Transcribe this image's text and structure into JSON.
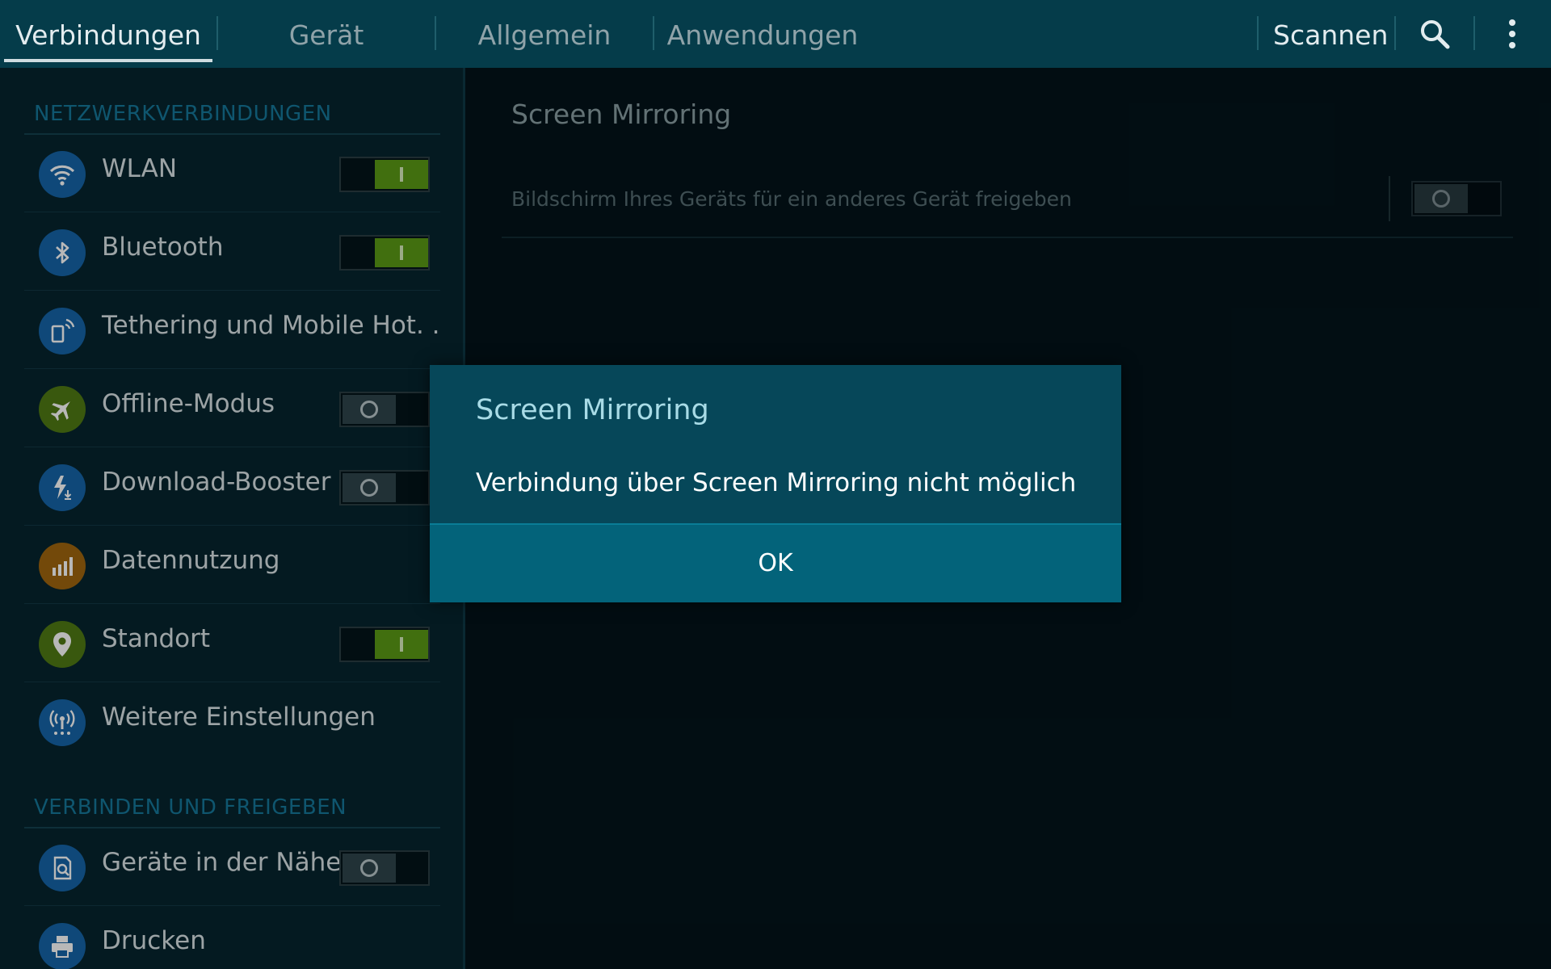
{
  "tabs": [
    {
      "label": "Verbindungen",
      "active": true
    },
    {
      "label": "Gerät",
      "active": false
    },
    {
      "label": "Allgemein",
      "active": false
    },
    {
      "label": "Anwendungen",
      "active": false
    }
  ],
  "actions": {
    "scan_label": "Scannen",
    "search_icon": "search-icon",
    "overflow_icon": "overflow-menu-icon"
  },
  "sidebar": {
    "sections": [
      {
        "header": "NETZWERKVERBINDUNGEN",
        "items": [
          {
            "label": "WLAN",
            "icon": "wifi-icon",
            "icon_color": "#1565a8",
            "toggle": "on"
          },
          {
            "label": "Bluetooth",
            "icon": "bluetooth-icon",
            "icon_color": "#1565a8",
            "toggle": "on"
          },
          {
            "label": "Tethering und Mobile Hot. .",
            "icon": "tethering-icon",
            "icon_color": "#1565a8",
            "toggle": "none"
          },
          {
            "label": "Offline-Modus",
            "icon": "airplane-icon",
            "icon_color": "#4f7a14",
            "toggle": "off"
          },
          {
            "label": "Download-Booster",
            "icon": "download-booster-icon",
            "icon_color": "#1565a8",
            "toggle": "off"
          },
          {
            "label": "Datennutzung",
            "icon": "data-usage-icon",
            "icon_color": "#a0660e",
            "toggle": "none"
          },
          {
            "label": "Standort",
            "icon": "location-icon",
            "icon_color": "#4f7a14",
            "toggle": "on"
          },
          {
            "label": "Weitere Einstellungen",
            "icon": "more-networks-icon",
            "icon_color": "#1565a8",
            "toggle": "none"
          }
        ]
      },
      {
        "header": "VERBINDEN UND FREIGEBEN",
        "items": [
          {
            "label": "Geräte in der Nähe",
            "icon": "nearby-devices-icon",
            "icon_color": "#1565a8",
            "toggle": "off"
          },
          {
            "label": "Drucken",
            "icon": "printer-icon",
            "icon_color": "#1565a8",
            "toggle": "none"
          }
        ]
      }
    ]
  },
  "content": {
    "title": "Screen Mirroring",
    "description": "Bildschirm Ihres Geräts für ein anderes Gerät freigeben",
    "toggle": "off"
  },
  "dialog": {
    "title": "Screen Mirroring",
    "message": "Verbindung über Screen Mirroring nicht möglich",
    "ok_label": "OK"
  },
  "colors": {
    "top_bar": "#053c4a",
    "sidebar_bg": "#06242e",
    "content_bg": "#03131a",
    "toggle_on": "#5a9a16",
    "section_header": "#16789a",
    "dialog_bg": "#064759",
    "dialog_button": "#03637a"
  }
}
